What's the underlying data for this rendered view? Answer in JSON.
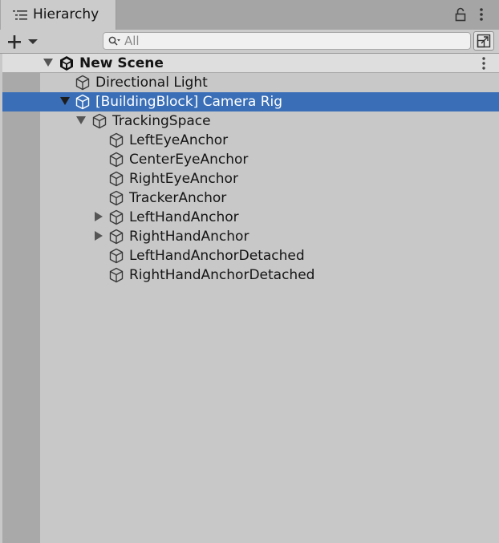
{
  "panel": {
    "title": "Hierarchy",
    "search_placeholder": "All"
  },
  "scene": {
    "name": "New Scene"
  },
  "items": [
    {
      "label": "Directional Light"
    },
    {
      "label": "[BuildingBlock] Camera Rig"
    },
    {
      "label": "TrackingSpace"
    },
    {
      "label": "LeftEyeAnchor"
    },
    {
      "label": "CenterEyeAnchor"
    },
    {
      "label": "RightEyeAnchor"
    },
    {
      "label": "TrackerAnchor"
    },
    {
      "label": "LeftHandAnchor"
    },
    {
      "label": "RightHandAnchor"
    },
    {
      "label": "LeftHandAnchorDetached"
    },
    {
      "label": "RightHandAnchorDetached"
    }
  ],
  "colors": {
    "selection": "#3a6fb7",
    "panel_bg": "#c8c8c8"
  },
  "icons": [
    "hierarchy-list-icon",
    "lock-icon",
    "more-options-icon",
    "plus-icon",
    "search-icon",
    "scene-visibility-icon",
    "unity-scene-icon",
    "game-object-cube-icon",
    "expand-arrow-icon"
  ]
}
